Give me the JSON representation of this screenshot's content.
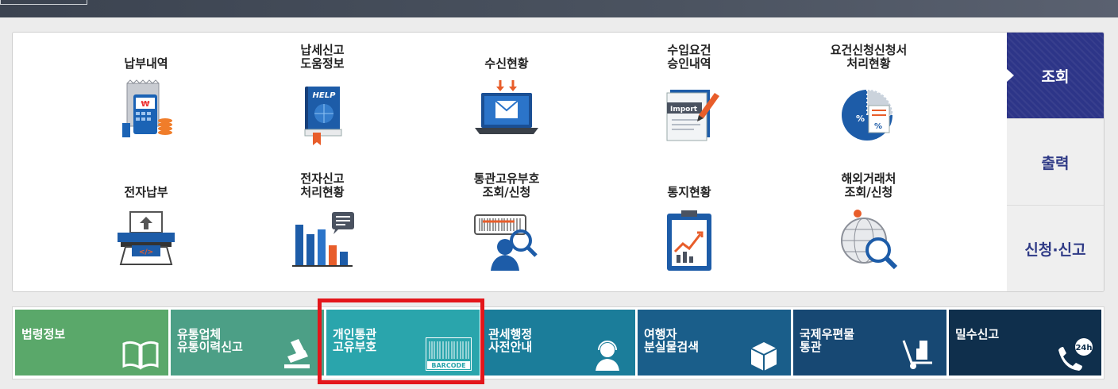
{
  "side_tabs": [
    {
      "label": "조회",
      "active": true
    },
    {
      "label": "출력",
      "active": false
    },
    {
      "label": "신청·신고",
      "active": false
    }
  ],
  "grid": [
    {
      "label": "납부내역",
      "icon": "cash-register-icon"
    },
    {
      "label": "납세신고\n도움정보",
      "icon": "help-book-icon"
    },
    {
      "label": "수신현황",
      "icon": "laptop-mail-icon"
    },
    {
      "label": "수입요건\n승인내역",
      "icon": "import-document-icon"
    },
    {
      "label": "요건신청신청서\n처리현황",
      "icon": "percentage-chart-icon"
    },
    {
      "label": "전자납부",
      "icon": "atm-payment-icon"
    },
    {
      "label": "전자신고\n처리현황",
      "icon": "bar-chart-icon"
    },
    {
      "label": "통관고유부호\n조회/신청",
      "icon": "barcode-search-icon"
    },
    {
      "label": "통지현황",
      "icon": "clipboard-chart-icon"
    },
    {
      "label": "해외거래처\n조회/신청",
      "icon": "globe-search-icon"
    }
  ],
  "bottom_tiles": [
    {
      "label": "법령정보",
      "icon": "open-book-icon",
      "color": "#5aa86a"
    },
    {
      "label": "유통업체\n유통이력신고",
      "icon": "stamp-icon",
      "color": "#4c9f86"
    },
    {
      "label": "개인통관\n고유부호",
      "icon": "barcode-icon",
      "color": "#2aa5ac",
      "badge": "BARCODE"
    },
    {
      "label": "관세행정\n사전안내",
      "icon": "support-agent-icon",
      "color": "#1b7d9a"
    },
    {
      "label": "여행자\n분실물검색",
      "icon": "package-icon",
      "color": "#1a5e8a"
    },
    {
      "label": "국제우편물\n통관",
      "icon": "hand-truck-icon",
      "color": "#174873"
    },
    {
      "label": "밀수신고",
      "icon": "phone-24h-icon",
      "color": "#0f2f4c",
      "badge": "24h"
    }
  ]
}
